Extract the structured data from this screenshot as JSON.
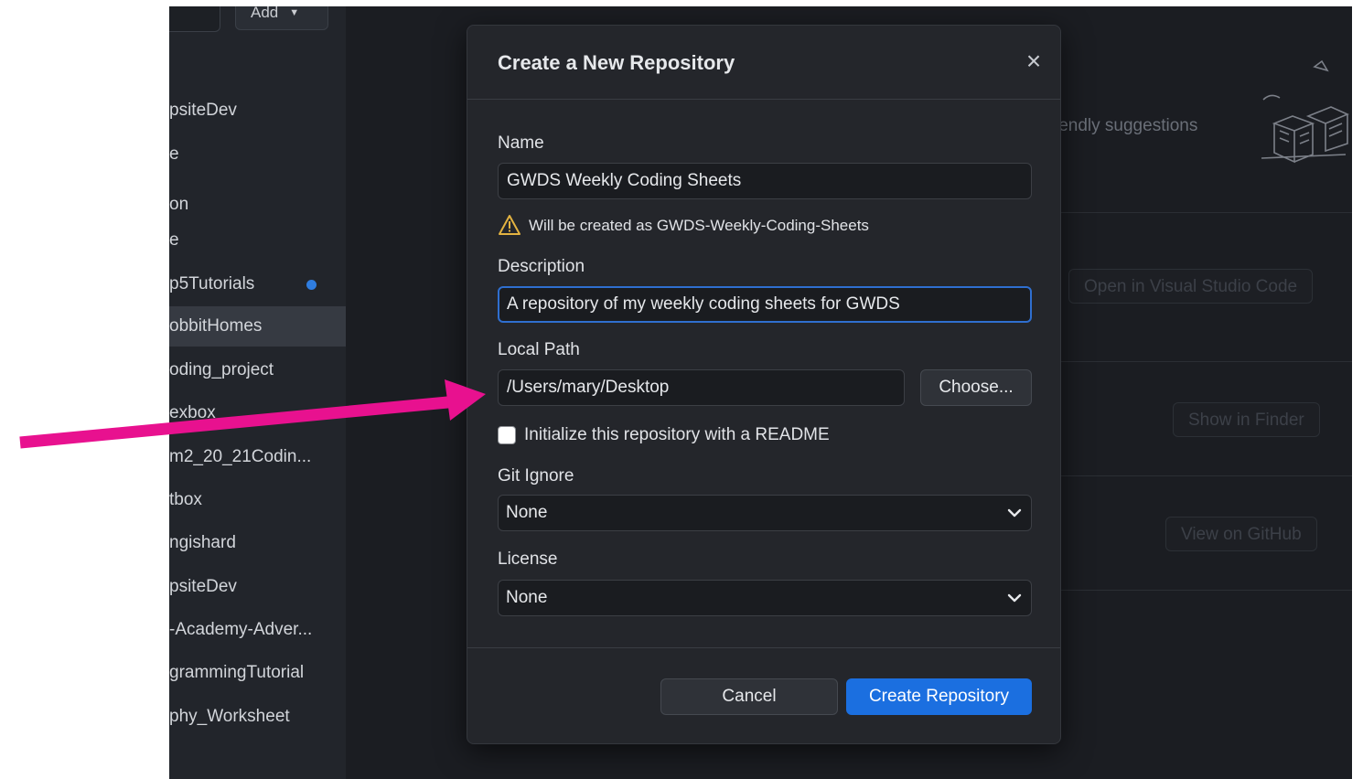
{
  "sidebar": {
    "add_label": "Add",
    "items": [
      {
        "label": "psiteDev"
      },
      {
        "label": "e"
      },
      {
        "label": "on"
      },
      {
        "label": "e"
      },
      {
        "label": "p5Tutorials"
      },
      {
        "label": "obbitHomes"
      },
      {
        "label": "oding_project"
      },
      {
        "label": "exbox"
      },
      {
        "label": "m2_20_21Codin..."
      },
      {
        "label": "tbox"
      },
      {
        "label": "ngishard"
      },
      {
        "label": "psiteDev"
      },
      {
        "label": "-Academy-Adver..."
      },
      {
        "label": "grammingTutorial"
      },
      {
        "label": "phy_Worksheet"
      }
    ]
  },
  "background": {
    "suggestions_text": "iendly suggestions",
    "open_vscode": "Open in Visual Studio Code",
    "show_finder": "Show in Finder",
    "view_github": "View on GitHub"
  },
  "dialog": {
    "title": "Create a New Repository",
    "close_symbol": "×",
    "name_label": "Name",
    "name_value": "GWDS Weekly Coding Sheets",
    "warning_text": "Will be created as GWDS-Weekly-Coding-Sheets",
    "description_label": "Description",
    "description_value": "A repository of my weekly coding sheets for GWDS",
    "local_path_label": "Local Path",
    "local_path_value": "/Users/mary/Desktop",
    "choose_label": "Choose...",
    "readme_label": "Initialize this repository with a README",
    "git_ignore_label": "Git Ignore",
    "git_ignore_value": "None",
    "license_label": "License",
    "license_value": "None",
    "cancel_label": "Cancel",
    "create_label": "Create Repository"
  },
  "annotation": {
    "arrow_color": "#e8118f"
  }
}
